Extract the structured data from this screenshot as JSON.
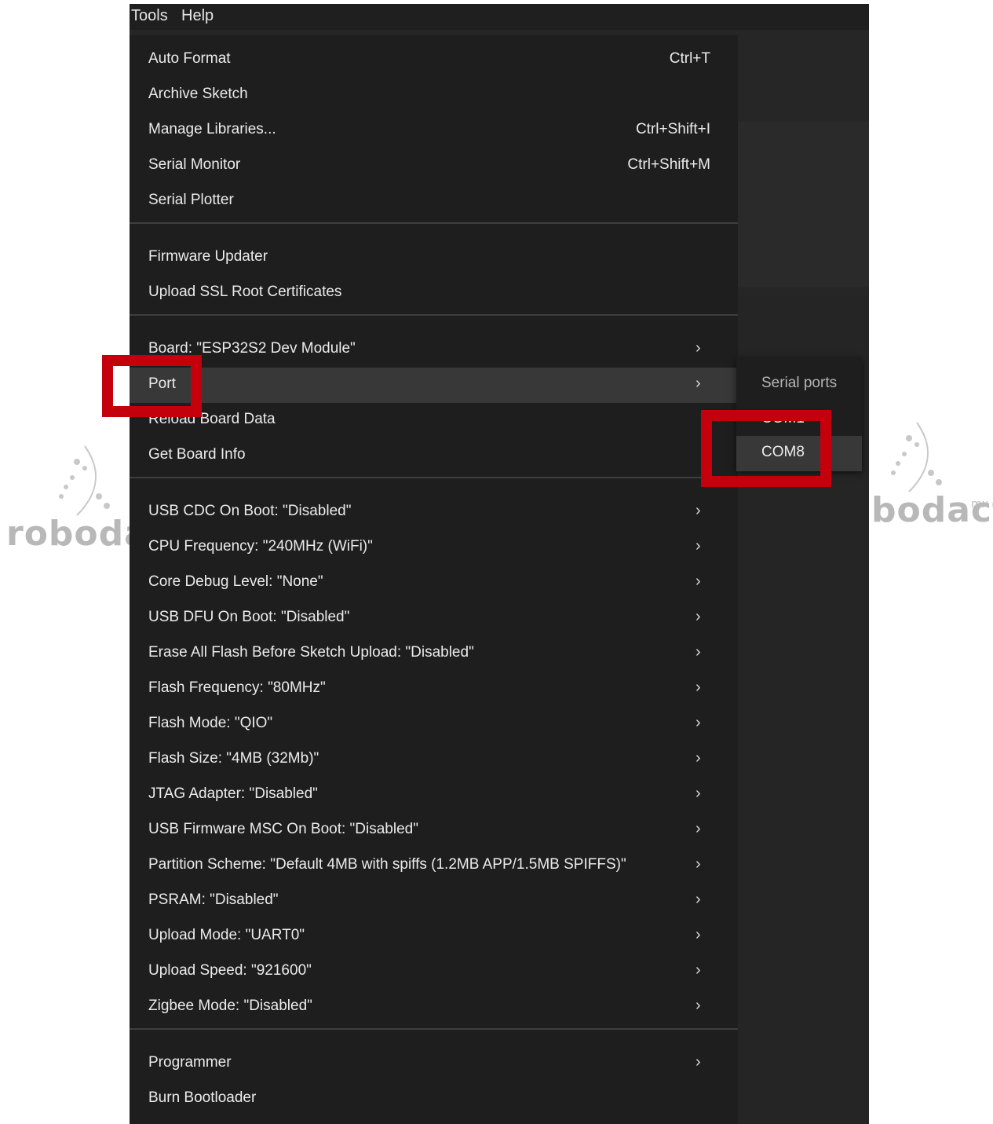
{
  "watermark": {
    "left_text": "robodac",
    "right_text": "bodacta",
    "right_suffix": "mx"
  },
  "menubar": {
    "tools": "Tools",
    "help": "Help"
  },
  "menu": {
    "groups": [
      [
        {
          "label": "Auto Format",
          "shortcut": "Ctrl+T"
        },
        {
          "label": "Archive Sketch",
          "shortcut": ""
        },
        {
          "label": "Manage Libraries...",
          "shortcut": "Ctrl+Shift+I"
        },
        {
          "label": "Serial Monitor",
          "shortcut": "Ctrl+Shift+M"
        },
        {
          "label": "Serial Plotter",
          "shortcut": ""
        }
      ],
      [
        {
          "label": "Firmware Updater"
        },
        {
          "label": "Upload SSL Root Certificates"
        }
      ],
      [
        {
          "label": "Board: \"ESP32S2 Dev Module\"",
          "submenu": true
        },
        {
          "label": "Port",
          "submenu": true,
          "active": true
        },
        {
          "label": "Reload Board Data"
        },
        {
          "label": "Get Board Info"
        }
      ],
      [
        {
          "label": "USB CDC On Boot: \"Disabled\"",
          "submenu": true
        },
        {
          "label": "CPU Frequency: \"240MHz (WiFi)\"",
          "submenu": true
        },
        {
          "label": "Core Debug Level: \"None\"",
          "submenu": true
        },
        {
          "label": "USB DFU On Boot: \"Disabled\"",
          "submenu": true
        },
        {
          "label": "Erase All Flash Before Sketch Upload: \"Disabled\"",
          "submenu": true
        },
        {
          "label": "Flash Frequency: \"80MHz\"",
          "submenu": true
        },
        {
          "label": "Flash Mode: \"QIO\"",
          "submenu": true
        },
        {
          "label": "Flash Size: \"4MB (32Mb)\"",
          "submenu": true
        },
        {
          "label": "JTAG Adapter: \"Disabled\"",
          "submenu": true
        },
        {
          "label": "USB Firmware MSC On Boot: \"Disabled\"",
          "submenu": true
        },
        {
          "label": "Partition Scheme: \"Default 4MB with spiffs (1.2MB APP/1.5MB SPIFFS)\"",
          "submenu": true
        },
        {
          "label": "PSRAM: \"Disabled\"",
          "submenu": true
        },
        {
          "label": "Upload Mode: \"UART0\"",
          "submenu": true
        },
        {
          "label": "Upload Speed: \"921600\"",
          "submenu": true
        },
        {
          "label": "Zigbee Mode: \"Disabled\"",
          "submenu": true
        }
      ],
      [
        {
          "label": "Programmer",
          "submenu": true
        },
        {
          "label": "Burn Bootloader"
        }
      ]
    ]
  },
  "chevron_glyph": "›",
  "submenu": {
    "header": "Serial ports",
    "ports": [
      {
        "label": "COM1",
        "selected": false
      },
      {
        "label": "COM8",
        "selected": true
      }
    ]
  },
  "colors": {
    "highlight_box": "#c4000c",
    "menu_bg": "#1e1e1e",
    "active_item": "#383838"
  }
}
